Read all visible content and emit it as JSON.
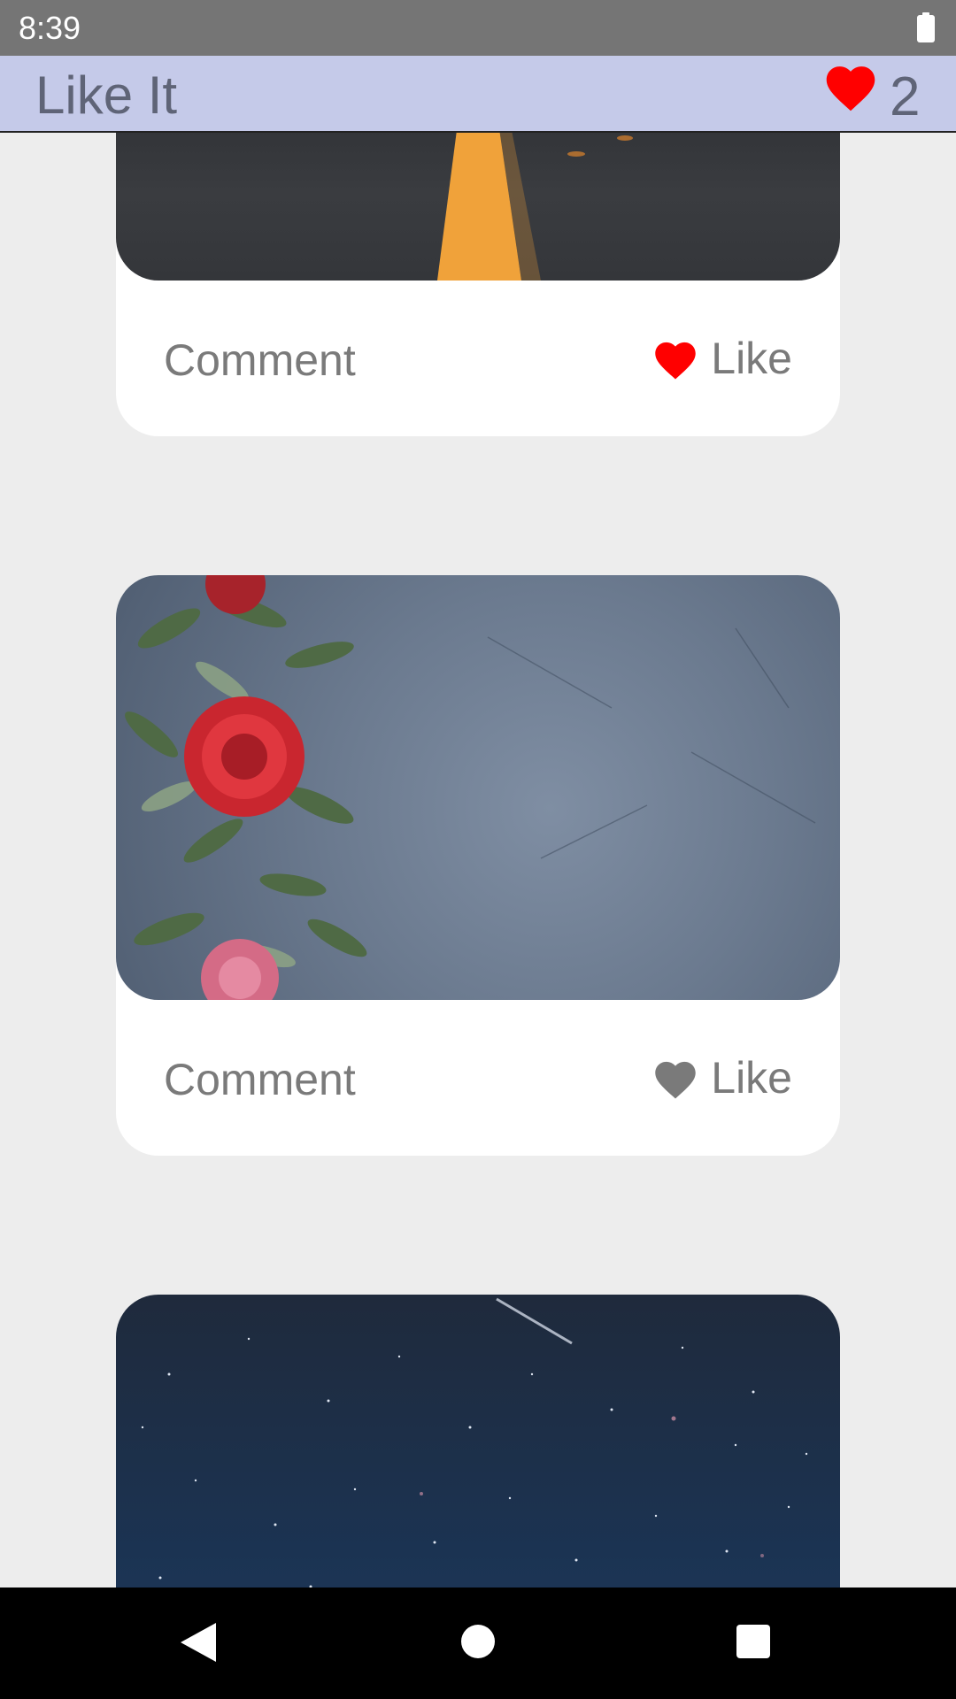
{
  "status_bar": {
    "time": "8:39",
    "battery_icon": "battery-full-icon"
  },
  "app_bar": {
    "title": "Like It",
    "likes_icon": "heart-icon",
    "likes_count": "2"
  },
  "posts": [
    {
      "image": "road with yellow center line",
      "comment_label": "Comment",
      "like_label": "Like",
      "liked": true
    },
    {
      "image": "red roses and leaves on grey concrete",
      "comment_label": "Comment",
      "like_label": "Like",
      "liked": false
    },
    {
      "image": "starry night sky",
      "comment_label": "Comment",
      "like_label": "Like",
      "liked": false
    }
  ],
  "colors": {
    "app_bar": "#c5cae9",
    "liked_heart": "#ff0000",
    "unliked_heart": "#7a7a7a",
    "background": "#ededed"
  },
  "nav_bar": {
    "back_icon": "back-triangle-icon",
    "home_icon": "home-circle-icon",
    "recents_icon": "recents-square-icon"
  }
}
